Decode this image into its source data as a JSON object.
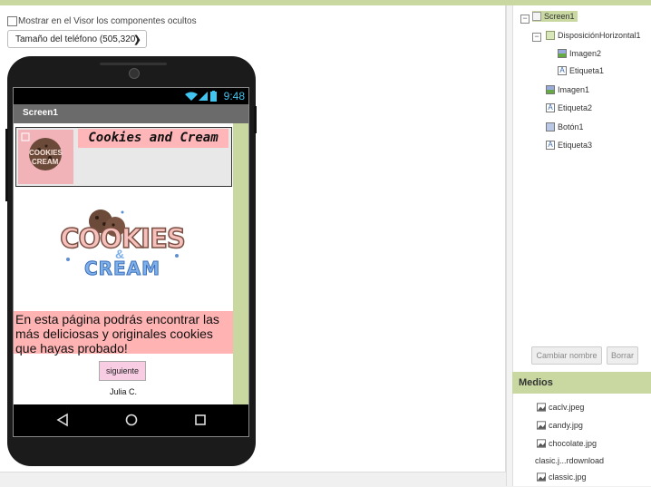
{
  "viewer": {
    "show_hidden_label": "Mostrar en el Visor los componentes ocultos",
    "phone_size_value": "Tamaño del teléfono (505,320)"
  },
  "phone": {
    "status_time": "9:48",
    "screen_title": "Screen1",
    "label1_text": "Cookies and Cream",
    "label2_text": "En esta página podrás encontrar las más deliciosas y originales cookies que hayas probado!",
    "button_text": "siguiente",
    "label3_text": "Julia C.",
    "logo_small_text_top": "COOKIES",
    "logo_small_text_bottom": "CREAM",
    "logo_main_top": "COOKIES",
    "logo_main_amp": "&",
    "logo_main_bottom": "CREAM"
  },
  "components": {
    "items": [
      {
        "label": "Screen1",
        "icon": "screen-icon"
      },
      {
        "label": "DisposiciónHorizontal1",
        "icon": "horizontal-arrangement-icon"
      },
      {
        "label": "Imagen2",
        "icon": "image-icon"
      },
      {
        "label": "Etiqueta1",
        "icon": "label-icon"
      },
      {
        "label": "Imagen1",
        "icon": "image-icon"
      },
      {
        "label": "Etiqueta2",
        "icon": "label-icon"
      },
      {
        "label": "Botón1",
        "icon": "button-icon"
      },
      {
        "label": "Etiqueta3",
        "icon": "label-icon"
      }
    ],
    "rename_label": "Cambiar nombre",
    "delete_label": "Borrar"
  },
  "media": {
    "title": "Medios",
    "items": [
      "caclv.jpeg",
      "candy.jpg",
      "chocolate.jpg",
      "clasic.j...rdownload",
      "classic.jpg"
    ]
  },
  "colors": {
    "accent": "#c8d8a0",
    "label_pink": "#ffb6b9",
    "button_pink": "#f8cde3",
    "status_blue": "#41c4f0"
  }
}
